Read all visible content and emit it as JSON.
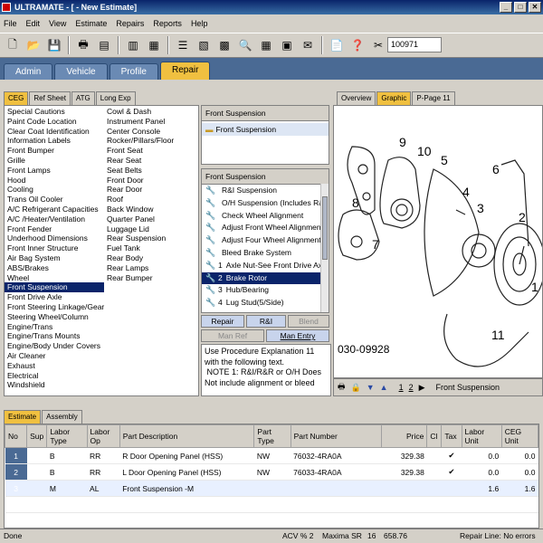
{
  "window": {
    "title": "ULTRAMATE - [ - New Estimate]"
  },
  "menu": [
    "File",
    "Edit",
    "View",
    "Estimate",
    "Repairs",
    "Reports",
    "Help"
  ],
  "toolbar": {
    "estimate_number": "100971"
  },
  "main_tabs": [
    "Admin",
    "Vehicle",
    "Profile",
    "Repair"
  ],
  "sub_tabs": [
    "CEG",
    "Ref Sheet",
    "ATG",
    "Long Exp"
  ],
  "categories_col1": [
    "Special Cautions",
    "Paint Code Location",
    "Clear Coat Identification",
    "Information Labels",
    "Front Bumper",
    "Grille",
    "Front Lamps",
    "Hood",
    "Cooling",
    "Trans Oil Cooler",
    "A/C Refrigerant Capacities",
    "A/C /Heater/Ventilation",
    "Front Fender",
    "Underhood Dimensions",
    "Front Inner Structure",
    "Air Bag System",
    "ABS/Brakes",
    "Wheel",
    "Front Suspension",
    "Front Drive Axle",
    "Front Steering Linkage/Gear",
    "Steering Wheel/Column",
    "Engine/Trans",
    "Engine/Trans Mounts",
    "Engine/Body Under Covers",
    "Air Cleaner",
    "Exhaust",
    "Electrical",
    "Windshield"
  ],
  "categories_col2": [
    "Cowl & Dash",
    "Instrument Panel",
    "Center Console",
    "Rocker/Pillars/Floor",
    "Front Seat",
    "Rear Seat",
    "Seat Belts",
    "Front Door",
    "Rear Door",
    "Roof",
    "Back Window",
    "Quarter Panel",
    "Luggage Lid",
    "Rear Suspension",
    "Fuel Tank",
    "Rear Body",
    "Rear Lamps",
    "Rear Bumper"
  ],
  "tree": {
    "header": "Front Suspension",
    "folder": "Front Suspension"
  },
  "operations": {
    "header": "Front Suspension",
    "items": [
      {
        "num": "",
        "label": "R&I Suspension"
      },
      {
        "num": "",
        "label": "O/H Suspension (Includes R&I)"
      },
      {
        "num": "",
        "label": "Check Wheel Alignment"
      },
      {
        "num": "",
        "label": "Adjust Front Wheel Alignment"
      },
      {
        "num": "",
        "label": "Adjust Four Wheel Alignment"
      },
      {
        "num": "",
        "label": "Bleed Brake System"
      },
      {
        "num": "1",
        "label": "Axle Nut-See Front Drive Axl..."
      },
      {
        "num": "2",
        "label": "Brake Rotor"
      },
      {
        "num": "3",
        "label": "Hub/Bearing"
      },
      {
        "num": "4",
        "label": "Lug Stud(5/Side)"
      }
    ]
  },
  "buttons": {
    "repair": "Repair",
    "ri": "R&I",
    "blend": "Blend",
    "man_ref": "Man Ref",
    "man_entry": "Man Entry"
  },
  "notes": "Use Procedure Explanation 11 with the following text.\n NOTE 1: R&I/R&R or O/H Does Not include alignment or bleed",
  "graphic_tabs": [
    "Overview",
    "Graphic",
    "P-Page 11"
  ],
  "graphic": {
    "callouts": [
      "9",
      "10",
      "5",
      "6",
      "8",
      "4",
      "3",
      "2",
      "7",
      "1",
      "11"
    ],
    "part_code": "030-09928",
    "pages": [
      "1",
      "2"
    ],
    "section": "Front Suspension"
  },
  "bottom_tabs": [
    "Estimate",
    "Assembly"
  ],
  "grid": {
    "columns": [
      "No",
      "Sup",
      "Labor Type",
      "Labor Op",
      "Part Description",
      "Part Type",
      "Part Number",
      "Price",
      "Cl",
      "Tax",
      "Labor Unit",
      "CEG Unit"
    ],
    "rows": [
      {
        "no": "1",
        "sup": "",
        "labor_type": "B",
        "labor_op": "RR",
        "desc": "R Door Opening Panel (HSS)",
        "ptype": "NW",
        "pnum": "76032-4RA0A",
        "price": "329.38",
        "cl": "",
        "tax": "✔",
        "labor": "0.0",
        "ceg": "0.0"
      },
      {
        "no": "2",
        "sup": "",
        "labor_type": "B",
        "labor_op": "RR",
        "desc": "L Door Opening Panel (HSS)",
        "ptype": "NW",
        "pnum": "76033-4RA0A",
        "price": "329.38",
        "cl": "",
        "tax": "✔",
        "labor": "0.0",
        "ceg": "0.0"
      },
      {
        "no": "3",
        "sup": "",
        "labor_type": "M",
        "labor_op": "AL",
        "desc": "Front Suspension          -M",
        "ptype": "",
        "pnum": "",
        "price": "",
        "cl": "",
        "tax": "",
        "labor": "1.6",
        "ceg": "1.6"
      }
    ]
  },
  "status": {
    "left": "Done",
    "acv": "ACV % 2",
    "model": "Maxima SR",
    "num": "16",
    "amount": "658.76",
    "repair_line": "Repair Line: No errors"
  }
}
